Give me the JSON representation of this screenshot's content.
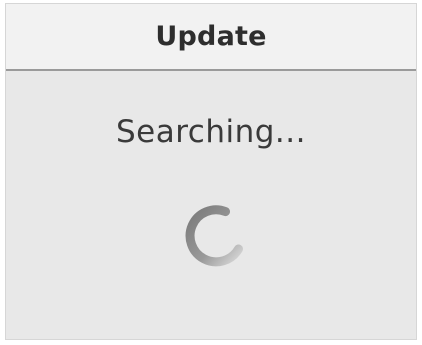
{
  "window": {
    "title": "Update"
  },
  "content": {
    "status_text": "Searching..."
  },
  "spinner": {
    "icon": "spinner-icon",
    "state": "loading"
  },
  "colors": {
    "background": "#e8e8e8",
    "titlebar": "#f2f2f2",
    "text": "#3a3a3a",
    "spinner": "#8a8a8a"
  }
}
